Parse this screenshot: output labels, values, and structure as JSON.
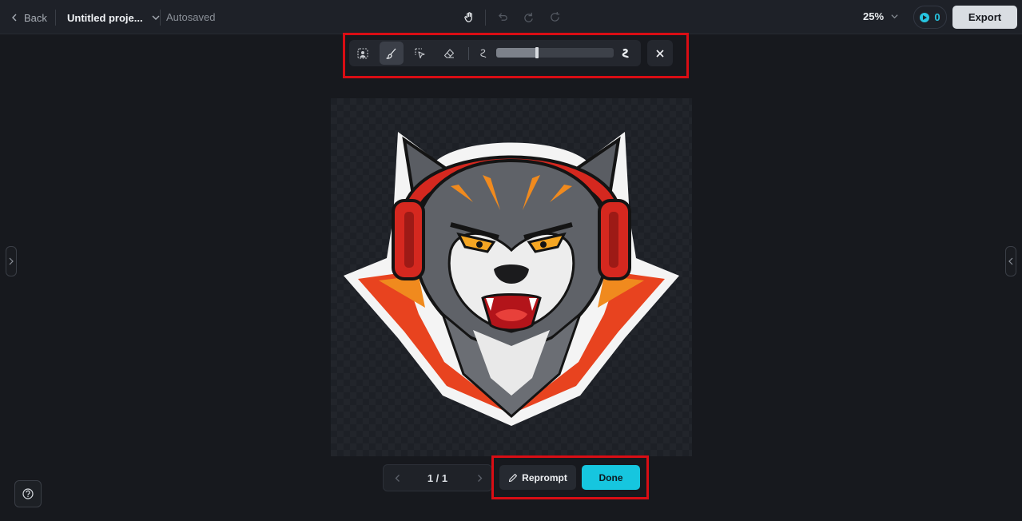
{
  "header": {
    "back_label": "Back",
    "project_title": "Untitled proje...",
    "autosave_status": "Autosaved",
    "zoom_level": "25%",
    "credits": "0",
    "export_label": "Export",
    "icons": [
      "chevron-left-icon",
      "chevron-down-icon",
      "hand-pan-icon",
      "undo-icon",
      "redo-icon",
      "refresh-icon"
    ]
  },
  "inpaint_toolbar": {
    "tools": [
      "subject-select-icon",
      "brush-icon",
      "lasso-select-icon",
      "eraser-icon"
    ],
    "active_tool": "brush",
    "brush_size_fraction": 0.35,
    "close_icon": "close-icon"
  },
  "canvas": {
    "image_subject": "wolf-with-headphones-mascot"
  },
  "pager": {
    "count": "1 / 1"
  },
  "actions": {
    "reprompt_label": "Reprompt",
    "done_label": "Done"
  },
  "colors": {
    "accent": "#16c6df",
    "highlight": "#d90d14",
    "background": "#17191e"
  }
}
